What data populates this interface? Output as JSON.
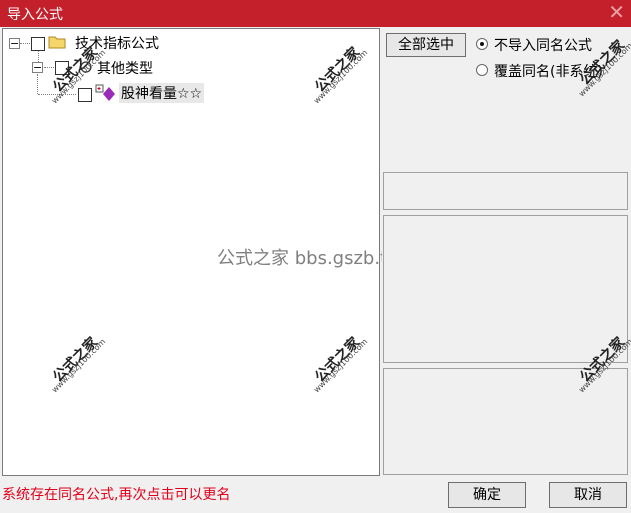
{
  "window": {
    "title": "导入公式",
    "close_glyph": "✕"
  },
  "tree": {
    "root": {
      "label": "技术指标公式",
      "expander": "−"
    },
    "child": {
      "label": "其他类型",
      "expander": "−"
    },
    "leaf": {
      "label": "股神看量☆☆"
    }
  },
  "options": {
    "select_all_label": "全部选中",
    "radio_skip_label": "不导入同名公式",
    "radio_overwrite_label": "覆盖同名(非系统)",
    "selected_option": "skip"
  },
  "status": {
    "message": "系统存在同名公式,再次点击可以更名",
    "color": "#e0001a"
  },
  "buttons": {
    "ok_label": "确定",
    "cancel_label": "取消"
  },
  "watermark": {
    "text": "公式之家",
    "url": "www.gszj100.com",
    "center_text": "公式之家 bbs.gszb.top"
  },
  "colors": {
    "titlebar": "#c4202c",
    "folder": "#f5d66b",
    "status": "#e0001a"
  }
}
